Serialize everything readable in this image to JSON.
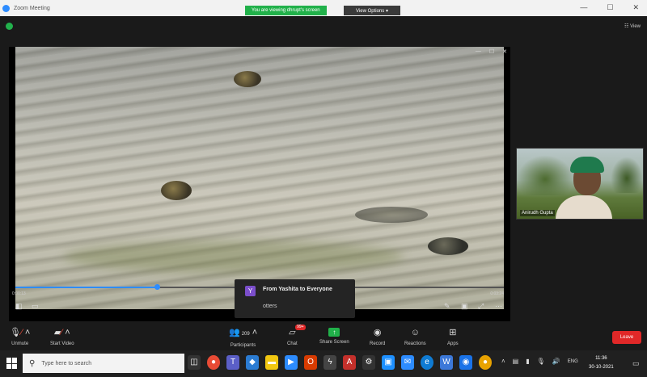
{
  "window": {
    "title": "Zoom Meeting",
    "controls": [
      "—",
      "☐",
      "✕"
    ]
  },
  "share_banner": {
    "text": "You are viewing dhrupt's screen",
    "view_options": "View Options ▾"
  },
  "view_label": "☷ View",
  "video": {
    "mini_controls": [
      "—",
      "☐",
      "✕"
    ],
    "time_elapsed": "0:00:13",
    "time_total": "0:03:24",
    "progress": 0.29
  },
  "participant": {
    "name": "Anirudh Gupta"
  },
  "chat_notification": {
    "avatar": "Y",
    "from": "From Yashita to Everyone",
    "message": "otters"
  },
  "toolbar": {
    "unmute": "Unmute",
    "start_video": "Start Video",
    "participants": "Participants",
    "participant_count": "209",
    "chat": "Chat",
    "chat_badge": "99+",
    "share_screen": "Share Screen",
    "record": "Record",
    "reactions": "Reactions",
    "apps": "Apps",
    "leave": "Leave"
  },
  "taskbar": {
    "search_placeholder": "Type here to search",
    "language": "ENG",
    "time": "11:36",
    "date": "30-10-2021"
  },
  "colors": {
    "zoom_blue": "#2d8cff",
    "share_green": "#21b14a",
    "leave_red": "#e02828"
  }
}
